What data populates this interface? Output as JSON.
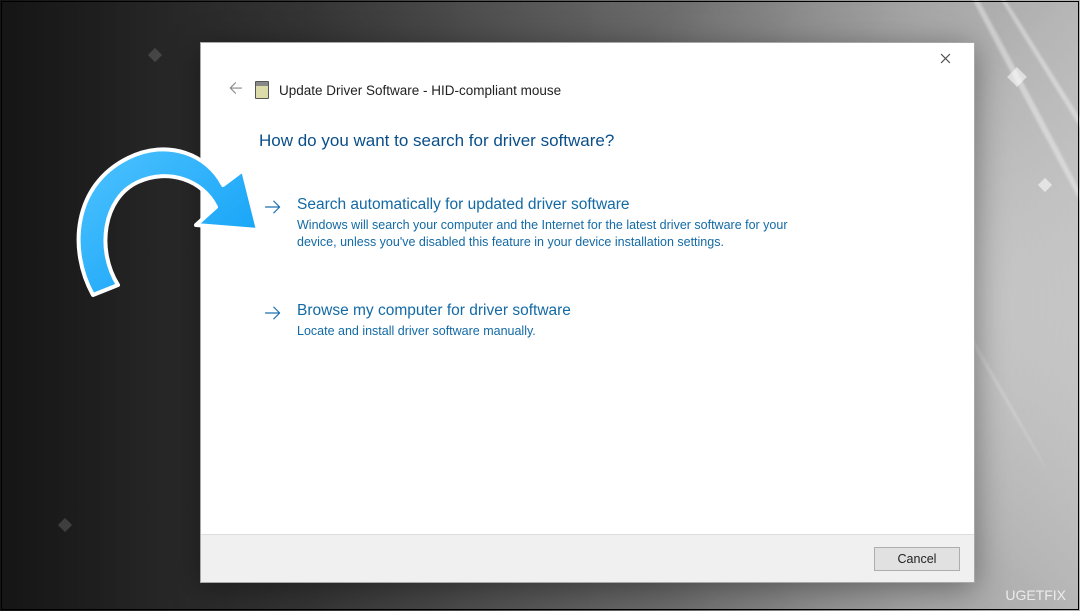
{
  "window": {
    "title": "Update Driver Software - HID-compliant mouse"
  },
  "heading": "How do you want to search for driver software?",
  "options": [
    {
      "title": "Search automatically for updated driver software",
      "desc": "Windows will search your computer and the Internet for the latest driver software for your device, unless you've disabled this feature in your device installation settings."
    },
    {
      "title": "Browse my computer for driver software",
      "desc": "Locate and install driver software manually."
    }
  ],
  "footer": {
    "cancel": "Cancel"
  },
  "watermark": "UGETFIX"
}
